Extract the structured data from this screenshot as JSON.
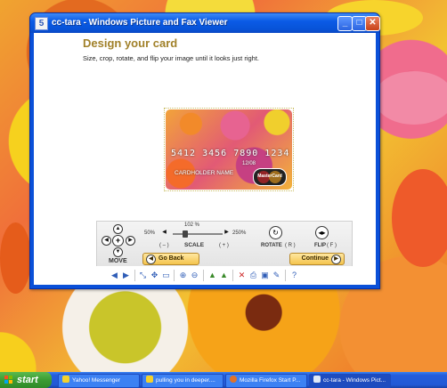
{
  "window": {
    "title": "cc-tara - Windows Picture and Fax Viewer",
    "app_icon": "picture-viewer-icon",
    "buttons": {
      "minimize": "_",
      "maximize": "□",
      "close": "✕"
    }
  },
  "page": {
    "title": "Design your card",
    "subtitle": "Size, crop, rotate, and flip your image until it looks just right."
  },
  "card": {
    "number": "5412 3456 7890 1234",
    "expiry": "12/08",
    "name": "CARDHOLDER NAME",
    "brand": "MasterCard"
  },
  "controls": {
    "move_label": "MOVE",
    "scale_min": "50%",
    "scale_max": "250%",
    "scale_value": "102 %",
    "scale_label": "SCALE",
    "scale_minus": "( – )",
    "scale_plus": "( + )",
    "rotate_label": "ROTATE",
    "rotate_key": "( R )",
    "flip_label": "FLIP",
    "flip_key": "( F )",
    "go_back": "Go Back",
    "continue": "Continue"
  },
  "viewer_toolbar": {
    "icons": [
      "previous-image-icon",
      "next-image-icon",
      "best-fit-icon",
      "actual-size-icon",
      "slideshow-icon",
      "zoom-in-icon",
      "zoom-out-icon",
      "rotate-clockwise-icon",
      "rotate-counterclockwise-icon",
      "delete-icon",
      "print-icon",
      "save-icon",
      "edit-icon",
      "help-icon"
    ]
  },
  "taskbar": {
    "start": "start",
    "tasks": [
      {
        "label": "Yahoo! Messenger",
        "active": false
      },
      {
        "label": "pulling you in deeper....",
        "active": false
      },
      {
        "label": "Mozilla Firefox Start P...",
        "active": false
      },
      {
        "label": "cc-tara - Windows Pict...",
        "active": true
      }
    ]
  },
  "colors": {
    "title_bar": "#0b5be6",
    "page_title": "#a1812a",
    "button_gold": "#f4c44c",
    "start_green": "#3c9c33"
  }
}
